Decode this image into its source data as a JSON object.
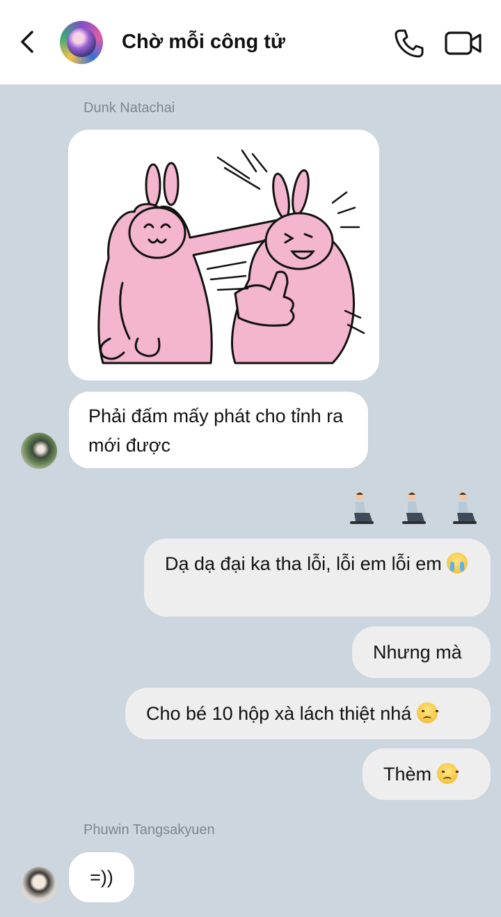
{
  "header": {
    "title": "Chờ mỗi công tử",
    "back_icon": "chevron-left-icon",
    "call_icon": "phone-icon",
    "video_icon": "video-camera-icon"
  },
  "messages": {
    "sender_1": "Dunk Natachai",
    "incoming_text_1": "Phải đấm mấy phát cho tỉnh ra mới được",
    "reaction_emojis": [
      "person-kneeling",
      "person-kneeling",
      "person-kneeling"
    ],
    "outgoing_1": "Dạ dạ đại ka tha lỗi, lỗi em lỗi em",
    "outgoing_2": "Nhưng mà",
    "outgoing_3": "Cho bé 10 hộp xà lách thiệt nhá",
    "outgoing_4": "Thèm",
    "sender_2": "Phuwin Tangsakyuen",
    "incoming_text_2": "=))"
  },
  "colors": {
    "background": "#ccd6de",
    "incoming_bubble": "#ffffff",
    "outgoing_bubble": "#eeeeef",
    "sticker_pink": "#f4b6cf"
  }
}
